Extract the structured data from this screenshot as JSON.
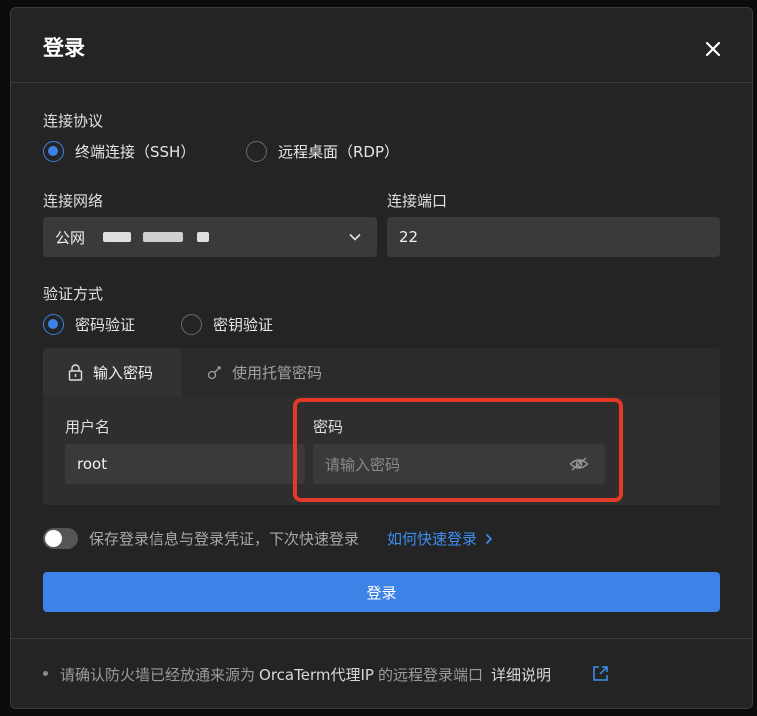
{
  "dialog": {
    "title": "登录",
    "close_icon": "close-icon"
  },
  "protocol": {
    "label": "连接协议",
    "options": [
      {
        "label": "终端连接（SSH）",
        "selected": true
      },
      {
        "label": "远程桌面（RDP）",
        "selected": false
      }
    ]
  },
  "network": {
    "label": "连接网络",
    "value": "公网",
    "chevron_icon": "chevron-down-icon"
  },
  "port": {
    "label": "连接端口",
    "value": "22"
  },
  "auth": {
    "label": "验证方式",
    "options": [
      {
        "label": "密码验证",
        "selected": true
      },
      {
        "label": "密钥验证",
        "selected": false
      }
    ],
    "tabs": [
      {
        "label": "输入密码",
        "icon": "lock-icon",
        "active": true
      },
      {
        "label": "使用托管密码",
        "icon": "key-icon",
        "active": false
      }
    ],
    "username_label": "用户名",
    "username_value": "root",
    "password_label": "密码",
    "password_placeholder": "请输入密码",
    "eye_icon": "eye-off-icon"
  },
  "save": {
    "toggle_on": false,
    "text": "保存登录信息与登录凭证，下次快速登录",
    "link": "如何快速登录"
  },
  "login_button": "登录",
  "footer": {
    "note_prefix": "请确认防火墙已经放通来源为",
    "note_highlight": "OrcaTerm代理IP",
    "note_suffix": "的远程登录端口",
    "detail_link": "详细说明",
    "link_icon": "external-link-icon"
  },
  "colors": {
    "accent": "#3d82e6",
    "highlight_box": "#e23a26",
    "background": "#242424"
  }
}
